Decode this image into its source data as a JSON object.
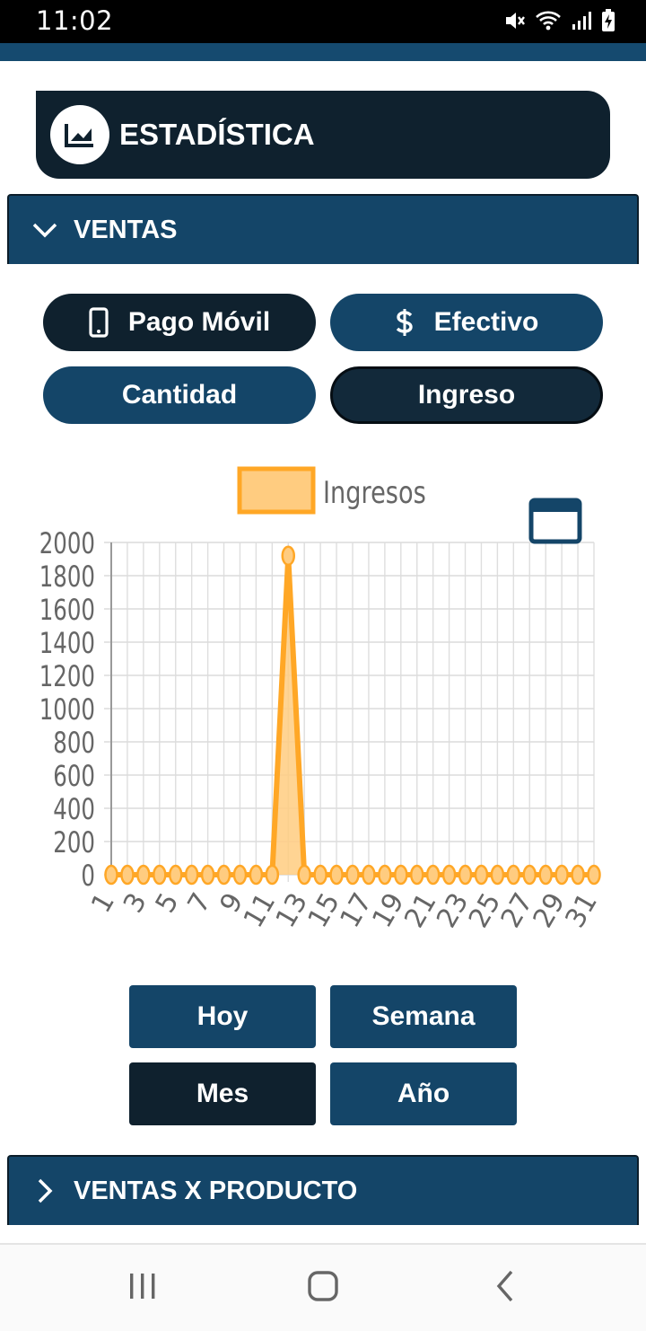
{
  "status_bar": {
    "time": "11:02"
  },
  "header": {
    "title": "ESTADÍSTICA",
    "icon": "chart-area-icon"
  },
  "section_ventas": {
    "title": "VENTAS",
    "icon": "chevron-down-icon"
  },
  "payment_buttons": {
    "pago_movil": {
      "label": "Pago Móvil",
      "icon": "smartphone-icon"
    },
    "efectivo": {
      "label": "Efectivo",
      "icon": "dollar-icon"
    }
  },
  "metric_buttons": {
    "cantidad": "Cantidad",
    "ingreso": "Ingreso"
  },
  "chart_data": {
    "type": "area",
    "legend": [
      "Ingresos"
    ],
    "legend_placement": "top",
    "series": [
      {
        "name": "Ingresos",
        "color": "#ffa726",
        "values": [
          0,
          0,
          0,
          0,
          0,
          0,
          0,
          0,
          0,
          0,
          0,
          1920,
          0,
          0,
          0,
          0,
          0,
          0,
          0,
          0,
          0,
          0,
          0,
          0,
          0,
          0,
          0,
          0,
          0,
          0,
          0
        ]
      }
    ],
    "x": [
      1,
      2,
      3,
      4,
      5,
      6,
      7,
      8,
      9,
      10,
      11,
      12,
      13,
      14,
      15,
      16,
      17,
      18,
      19,
      20,
      21,
      22,
      23,
      24,
      25,
      26,
      27,
      28,
      29,
      30,
      31
    ],
    "x_tick_labels": [
      "1",
      "3",
      "5",
      "7",
      "9",
      "11",
      "13",
      "15",
      "17",
      "19",
      "21",
      "23",
      "25",
      "27",
      "29",
      "31"
    ],
    "y_tick_labels": [
      "0",
      "200",
      "400",
      "600",
      "800",
      "1000",
      "1200",
      "1400",
      "1600",
      "1800",
      "2000"
    ],
    "ylim": [
      0,
      2000
    ],
    "grid": true
  },
  "period_buttons": {
    "hoy": "Hoy",
    "semana": "Semana",
    "mes": "Mes",
    "anio": "Año"
  },
  "section_productos": {
    "title": "VENTAS X PRODUCTO",
    "icon": "chevron-right-icon"
  },
  "colors": {
    "dark_navy": "#0f212e",
    "primary_blue": "#144568",
    "chart_orange": "#ffa726",
    "chart_fill": "#ffcc80"
  }
}
